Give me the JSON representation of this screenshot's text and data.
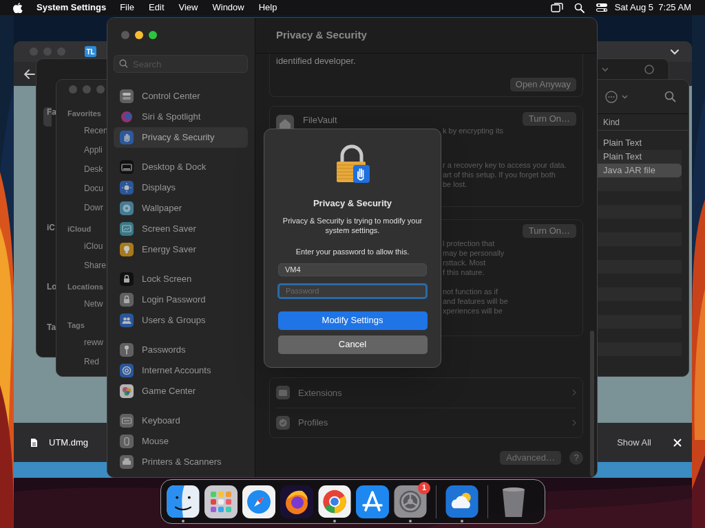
{
  "menu_bar": {
    "app_name": "System Settings",
    "menus": [
      "File",
      "Edit",
      "View",
      "Window",
      "Help"
    ],
    "clock": "Sat Aug 5  7:25 AM"
  },
  "browser_window": {
    "tab_favicon": "TL",
    "download_file": "UTM.dmg",
    "show_all": "Show All"
  },
  "finder_back": {
    "sidebar_labels": [
      "Fa",
      "iC",
      "Lo",
      "Ta"
    ]
  },
  "finder_front": {
    "sections": [
      {
        "heading": "Favorites",
        "items": [
          "Recen",
          "Appli",
          "Desk",
          "Docu",
          "Dowr"
        ]
      },
      {
        "heading": "iCloud",
        "items": [
          "iClou",
          "Share"
        ]
      },
      {
        "heading": "Locations",
        "items": [
          "Netw"
        ]
      },
      {
        "heading": "Tags",
        "items": [
          "reww",
          "Red"
        ]
      }
    ],
    "column_header": "Kind",
    "rows": [
      {
        "kind_text": "Plain Text",
        "selected": false
      },
      {
        "kind_text": "Plain Text",
        "selected": false
      },
      {
        "kind_text": "Java JAR file",
        "selected": true
      }
    ]
  },
  "settings": {
    "search_placeholder": "Search",
    "sidebar_groups": [
      [
        {
          "label": "Control Center",
          "kind": "toggles",
          "selected": false
        },
        {
          "label": "Siri & Spotlight",
          "kind": "orb",
          "selected": false
        },
        {
          "label": "Privacy & Security",
          "kind": "hand",
          "selected": true
        }
      ],
      [
        {
          "label": "Desktop & Dock",
          "kind": "monitor",
          "selected": false
        },
        {
          "label": "Displays",
          "kind": "sun",
          "selected": false
        },
        {
          "label": "Wallpaper",
          "kind": "flower",
          "selected": false
        },
        {
          "label": "Screen Saver",
          "kind": "screen",
          "selected": false
        },
        {
          "label": "Energy Saver",
          "kind": "bulb",
          "selected": false
        }
      ],
      [
        {
          "label": "Lock Screen",
          "kind": "lock",
          "selected": false
        },
        {
          "label": "Login Password",
          "kind": "lock2",
          "selected": false
        },
        {
          "label": "Users & Groups",
          "kind": "people",
          "selected": false
        }
      ],
      [
        {
          "label": "Passwords",
          "kind": "key",
          "selected": false
        },
        {
          "label": "Internet Accounts",
          "kind": "at",
          "selected": false
        },
        {
          "label": "Game Center",
          "kind": "bubbles",
          "selected": false
        }
      ],
      [
        {
          "label": "Keyboard",
          "kind": "keyboard",
          "selected": false
        },
        {
          "label": "Mouse",
          "kind": "mouse",
          "selected": false
        },
        {
          "label": "Printers & Scanners",
          "kind": "printer",
          "selected": false
        }
      ]
    ],
    "title": "Privacy & Security",
    "top_text": "identified developer.",
    "open_anyway": "Open Anyway",
    "filevault": {
      "title": "FileVault",
      "button": "Turn On…",
      "fragments": [
        "k by encrypting its",
        "r a recovery key to access your data.",
        "art of this setup. If you forget both",
        "be lost."
      ]
    },
    "lockdown": {
      "button": "Turn On…",
      "fragments": [
        "l protection that",
        "may be personally",
        "rsttack. Most",
        "f this nature.",
        "not function as if",
        "and features will be",
        "xperiences will be"
      ]
    },
    "rows": [
      {
        "label": "Extensions",
        "kind": "extensions"
      },
      {
        "label": "Profiles",
        "kind": "profiles"
      }
    ],
    "advanced": "Advanced…",
    "help": "?"
  },
  "dialog": {
    "title": "Privacy & Security",
    "message": "Privacy & Security is trying to modify your system settings.",
    "prompt": "Enter your password to allow this.",
    "username": "VM4",
    "password_placeholder": "Password",
    "password_focused": true,
    "primary": "Modify Settings",
    "cancel": "Cancel"
  },
  "dock": [
    {
      "kind": "finder",
      "running": true
    },
    {
      "kind": "launchpad",
      "running": false
    },
    {
      "kind": "safari",
      "running": false
    },
    {
      "kind": "firefox",
      "running": false
    },
    {
      "kind": "chrome",
      "running": true
    },
    {
      "kind": "appstore",
      "running": false
    },
    {
      "kind": "settings",
      "running": true,
      "badge": "1"
    },
    {
      "kind": "separator"
    },
    {
      "kind": "weather",
      "running": true
    },
    {
      "kind": "separator"
    },
    {
      "kind": "trash",
      "running": false
    }
  ]
}
